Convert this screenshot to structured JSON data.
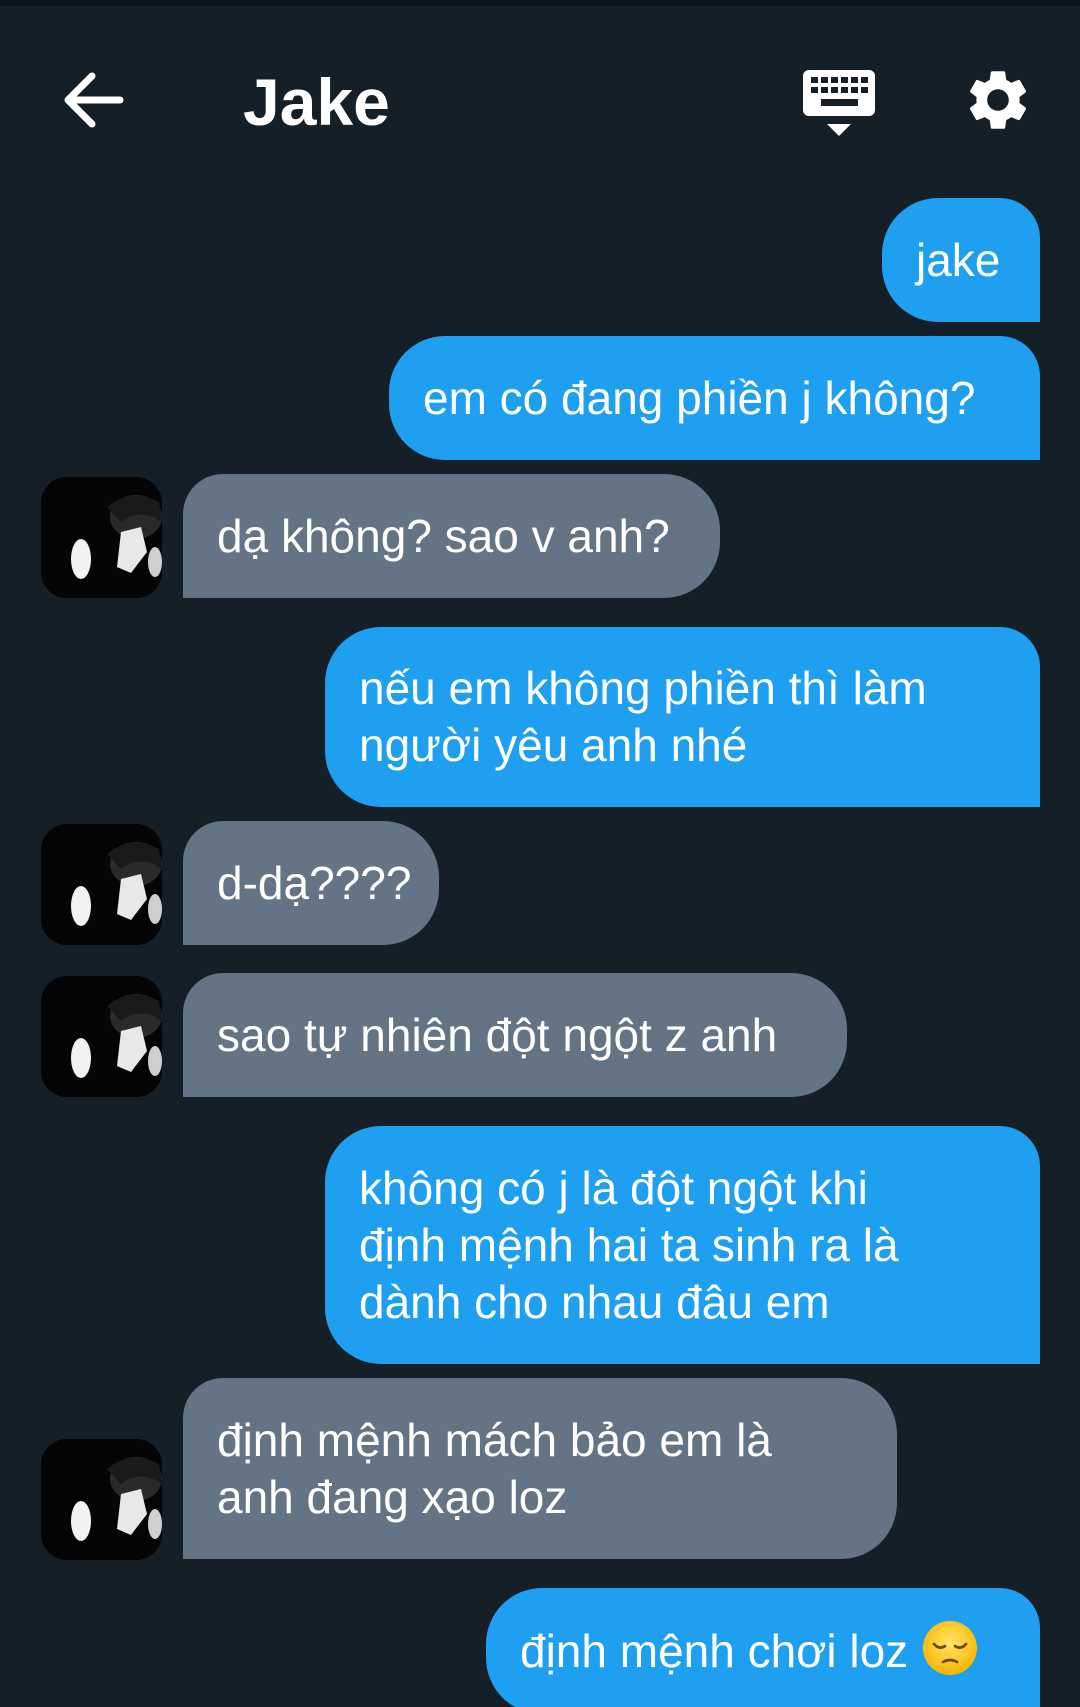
{
  "header": {
    "contact_name": "Jake",
    "back_icon": "arrow-left-icon",
    "keyboard_icon": "keyboard-icon",
    "settings_icon": "gear-icon"
  },
  "colors": {
    "background": "#151f28",
    "sent_bubble": "#1e9ff0",
    "received_bubble": "#647484",
    "text": "#ffffff"
  },
  "messages": [
    {
      "side": "sent",
      "lines": [
        "jake"
      ]
    },
    {
      "side": "sent",
      "lines": [
        "em có đang phiền j không?"
      ]
    },
    {
      "side": "received",
      "lines": [
        "dạ không? sao v anh?"
      ]
    },
    {
      "side": "sent",
      "lines": [
        "nếu em không phiền thì làm",
        "người yêu anh nhé"
      ]
    },
    {
      "side": "received",
      "lines": [
        "d-dạ????"
      ]
    },
    {
      "side": "received",
      "lines": [
        "sao tự nhiên đột ngột z anh"
      ]
    },
    {
      "side": "sent",
      "lines": [
        "không có j là đột ngột khi",
        "định mệnh hai ta sinh ra là",
        "dành cho nhau đâu em"
      ]
    },
    {
      "side": "received",
      "lines": [
        "định mệnh mách bảo em là",
        "anh đang xạo loz"
      ]
    },
    {
      "side": "sent",
      "lines": [
        "định mệnh chơi loz"
      ],
      "emoji": "pensive-face-icon"
    }
  ]
}
